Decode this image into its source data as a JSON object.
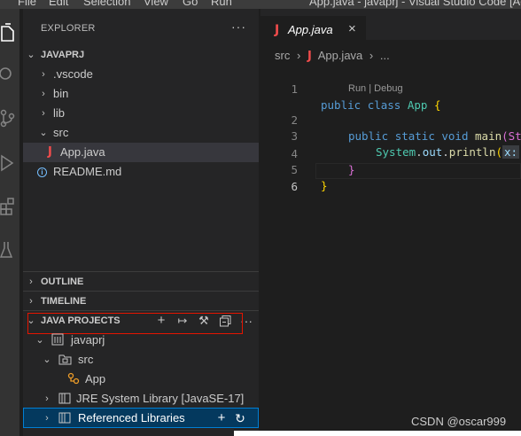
{
  "menu": [
    "File",
    "Edit",
    "Selection",
    "View",
    "Go",
    "Run"
  ],
  "window_title": "App.java - javaprj - Visual Studio Code [Administrator]",
  "activity_bar": {
    "icons": [
      "explorer-icon",
      "search-icon",
      "source-control-icon",
      "run-debug-icon",
      "extensions-icon",
      "testing-icon"
    ]
  },
  "explorer": {
    "header": "EXPLORER",
    "more": "···",
    "project_header": "JAVAPRJ",
    "tree": [
      {
        "label": ".vscode",
        "chevron": "›"
      },
      {
        "label": "bin",
        "chevron": "›"
      },
      {
        "label": "lib",
        "chevron": "›"
      },
      {
        "label": "src",
        "chevron": "⌄"
      },
      {
        "label": "App.java",
        "icon": "J"
      },
      {
        "label": "README.md",
        "icon": "i"
      }
    ]
  },
  "panels": {
    "outline": "OUTLINE",
    "timeline": "TIMELINE",
    "java_projects": "JAVA PROJECTS",
    "java_projects_more": "···"
  },
  "java_projects": {
    "tree": [
      {
        "label": "javaprj"
      },
      {
        "label": "src"
      },
      {
        "label": "App"
      },
      {
        "label": "JRE System Library [JavaSE-17]"
      },
      {
        "label": "Referenced Libraries"
      }
    ]
  },
  "editor": {
    "tab": {
      "icon": "J",
      "label": "App.java",
      "close": "×"
    },
    "breadcrumbs": [
      "src",
      "›",
      "J",
      "App.java",
      "›",
      "..."
    ],
    "codelens": "Run | Debug",
    "line_numbers": [
      "1",
      "2",
      "3",
      "4",
      "5",
      "6"
    ],
    "code": {
      "l1": [
        "public",
        "class",
        "App",
        "{"
      ],
      "l2": [
        "public",
        "static",
        "void",
        "main",
        "(St"
      ],
      "l3": [
        "System",
        ".",
        "out",
        ".",
        "println",
        "(",
        "x:"
      ],
      "l4": [
        "}"
      ],
      "l5": [
        "}"
      ]
    }
  },
  "watermark": "CSDN @oscar999",
  "colors": {
    "accent_red": "#e51400",
    "selection_blue": "#007fd4",
    "java_red": "#f14c4c"
  }
}
